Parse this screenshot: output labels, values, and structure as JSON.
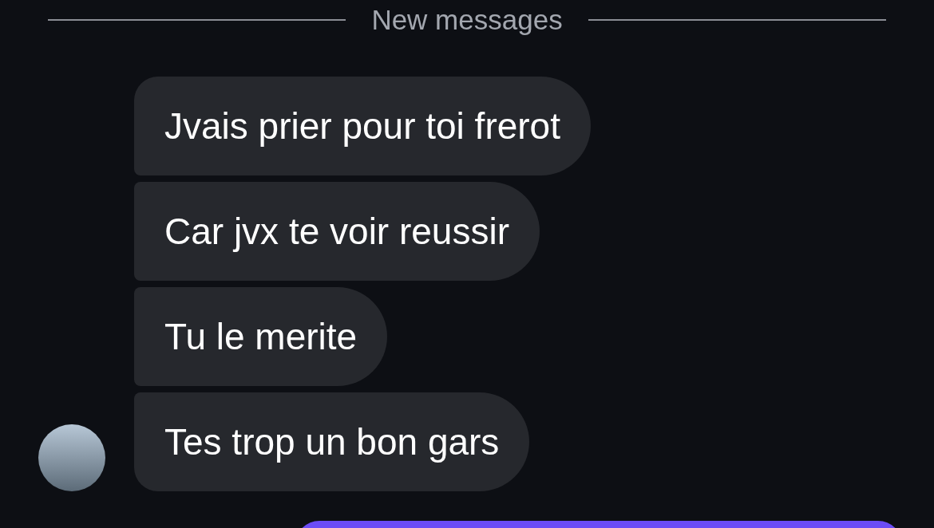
{
  "divider": {
    "label": "New messages"
  },
  "incoming_messages": [
    {
      "text": "Jvais prier pour toi frerot"
    },
    {
      "text": "Car jvx te voir reussir"
    },
    {
      "text": "Tu le merite"
    },
    {
      "text": "Tes trop un bon gars"
    }
  ],
  "outgoing_bubble_visible": true
}
